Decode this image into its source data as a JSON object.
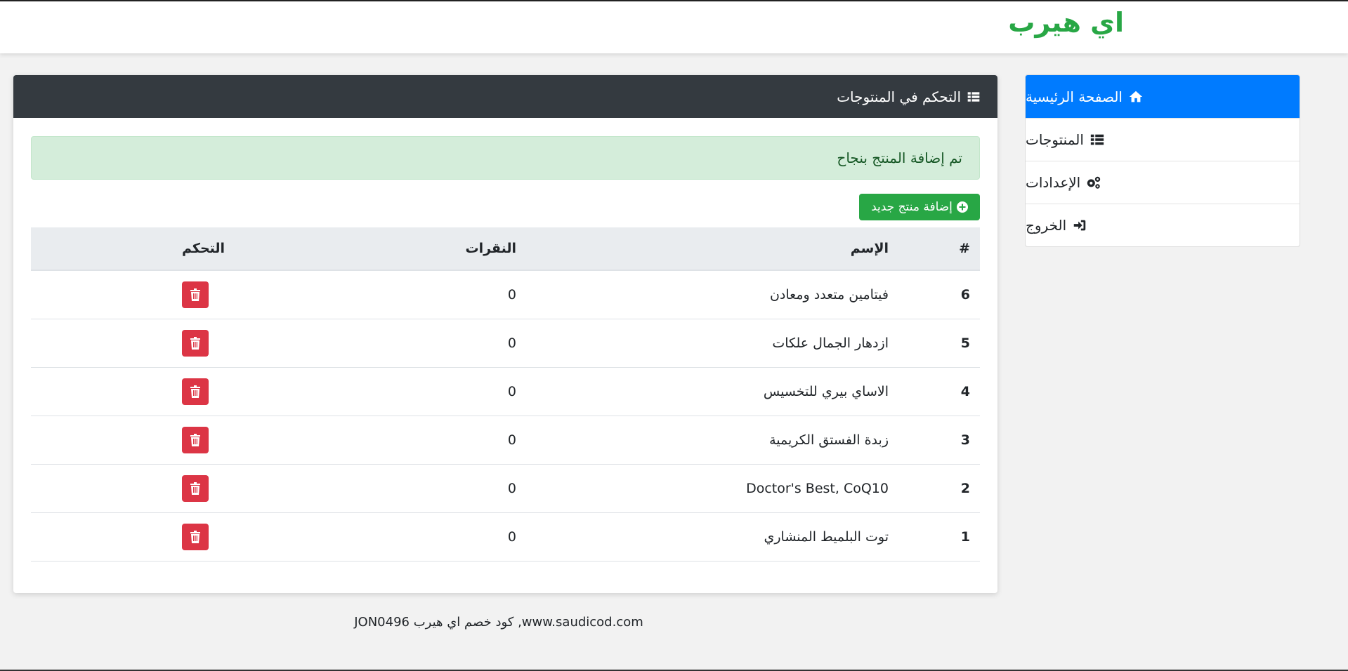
{
  "brand": {
    "logo_text": "اي هيرب",
    "logo_color": "#28a745"
  },
  "sidebar": {
    "items": [
      {
        "label": "الصفحة الرئيسية",
        "icon": "home-icon",
        "active": true
      },
      {
        "label": "المنتوجات",
        "icon": "list-icon",
        "active": false
      },
      {
        "label": "الإعدادات",
        "icon": "gears-icon",
        "active": false
      },
      {
        "label": "الخروج",
        "icon": "sign-in-icon",
        "active": false
      }
    ],
    "active_color": "#007bff"
  },
  "card": {
    "title": "التحكم في المنتوجات",
    "title_icon": "list-icon",
    "alert_text": "تم إضافة المنتج بنجاح",
    "add_button_label": "إضافة منتج جديد",
    "add_button_icon": "plus-circle-icon"
  },
  "table": {
    "headers": {
      "num": "#",
      "name": "الإسم",
      "clicks": "النقرات",
      "actions": "التحكم"
    },
    "rows": [
      {
        "num": "6",
        "name": "فيتامين متعدد ومعادن",
        "clicks": "0"
      },
      {
        "num": "5",
        "name": "ازدهار الجمال علكات",
        "clicks": "0"
      },
      {
        "num": "4",
        "name": "الاساي بيري للتخسيس",
        "clicks": "0"
      },
      {
        "num": "3",
        "name": "زبدة الفستق الكريمية",
        "clicks": "0"
      },
      {
        "num": "2",
        "name": "Doctor's Best, CoQ10",
        "clicks": "0"
      },
      {
        "num": "1",
        "name": "توت البلميط المنشاري",
        "clicks": "0"
      }
    ],
    "delete_icon": "trash-icon",
    "delete_color": "#dc3545"
  },
  "footer": {
    "text": "www.saudicod.com, كود خصم اي هيرب JON0496"
  }
}
